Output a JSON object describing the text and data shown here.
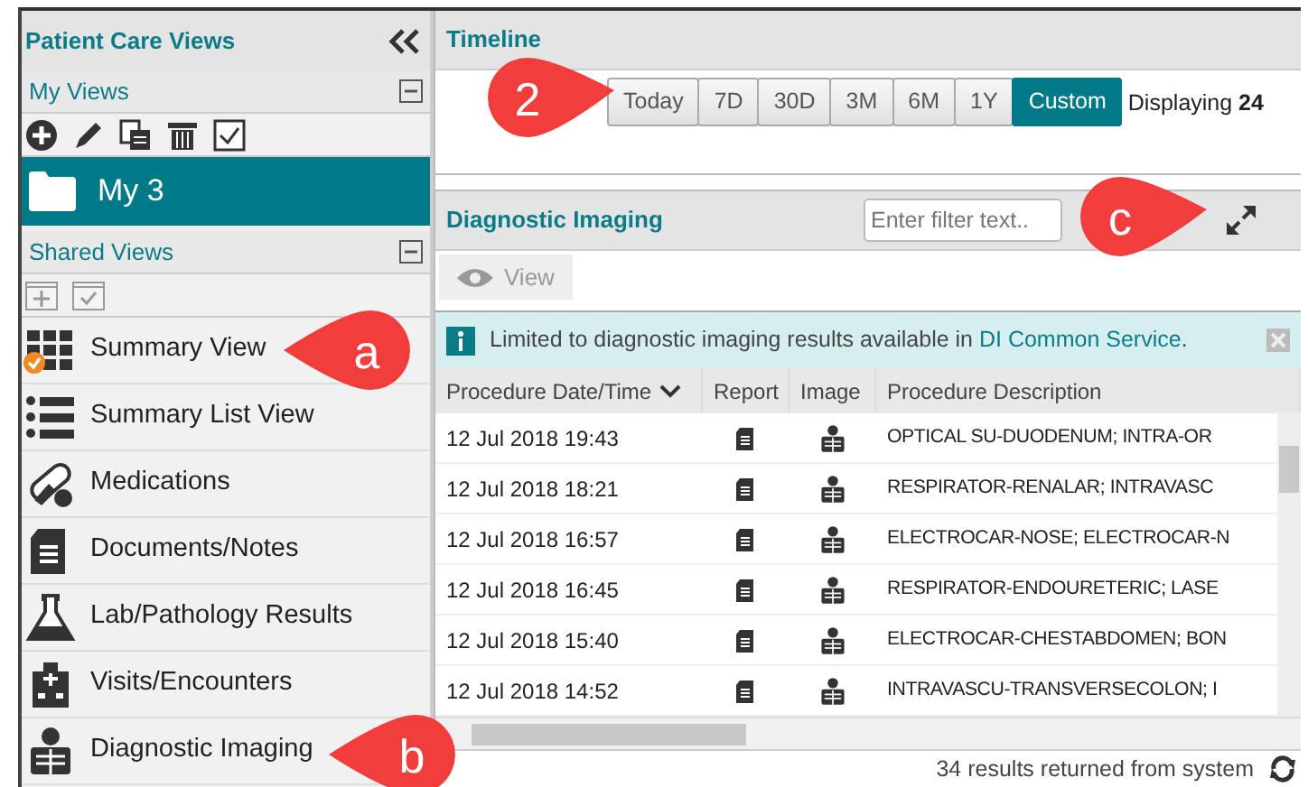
{
  "sidebar": {
    "title": "Patient Care Views",
    "my_views": {
      "label": "My Views",
      "expanded": true,
      "views": [
        {
          "label": "My 3",
          "selected": true
        }
      ]
    },
    "shared_views": {
      "label": "Shared Views",
      "expanded": true
    },
    "items": [
      {
        "label": "Summary View",
        "kind": "grid",
        "checked": true
      },
      {
        "label": "Summary List View",
        "kind": "list",
        "checked": false
      },
      {
        "label": "Medications",
        "kind": "pills",
        "checked": false
      },
      {
        "label": "Documents/Notes",
        "kind": "document",
        "checked": false
      },
      {
        "label": "Lab/Pathology Results",
        "kind": "flask",
        "checked": false
      },
      {
        "label": "Visits/Encounters",
        "kind": "hospital",
        "checked": false
      },
      {
        "label": "Diagnostic Imaging",
        "kind": "xray",
        "checked": false
      }
    ]
  },
  "timeline": {
    "title": "Timeline",
    "ranges": [
      {
        "label": "Today",
        "selected": false
      },
      {
        "label": "7D",
        "selected": false
      },
      {
        "label": "30D",
        "selected": false
      },
      {
        "label": "3M",
        "selected": false
      },
      {
        "label": "6M",
        "selected": false
      },
      {
        "label": "1Y",
        "selected": false
      },
      {
        "label": "Custom",
        "selected": true
      }
    ],
    "displaying": "Displaying **24**"
  },
  "imaging": {
    "title": "Diagnostic Imaging",
    "filter": {
      "placeholder": "Enter filter text.."
    },
    "view_button": {
      "label": "View",
      "disabled": true
    },
    "notice": {
      "text": "Limited to diagnostic imaging results available in ",
      "link": "DI Common Service",
      "end": "."
    },
    "columns": [
      {
        "label": "Procedure Date/Time",
        "sorted": true
      },
      {
        "label": "Report",
        "sorted": false
      },
      {
        "label": "Image",
        "sorted": false
      },
      {
        "label": "Procedure Description",
        "sorted": false
      }
    ],
    "rows": [
      {
        "date": "12 Jul 2018 19:43",
        "description": "OPTICAL SU-DUODENUM; INTRA-OR"
      },
      {
        "date": "12 Jul 2018 18:21",
        "description": "RESPIRATOR-RENALAR; INTRAVASC"
      },
      {
        "date": "12 Jul 2018 16:57",
        "description": "ELECTROCAR-NOSE; ELECTROCAR-N"
      },
      {
        "date": "12 Jul 2018 16:45",
        "description": "RESPIRATOR-ENDOURETERIC; LASE"
      },
      {
        "date": "12 Jul 2018 15:40",
        "description": "ELECTROCAR-CHESTABDOMEN; BON"
      },
      {
        "date": "12 Jul 2018 14:52",
        "description": "INTRAVASCU-TRANSVERSECOLON; I"
      }
    ],
    "footer": "34 results returned from system"
  },
  "callouts": [
    {
      "label": "2"
    },
    {
      "label": "c"
    },
    {
      "label": "a"
    },
    {
      "label": "b"
    }
  ]
}
